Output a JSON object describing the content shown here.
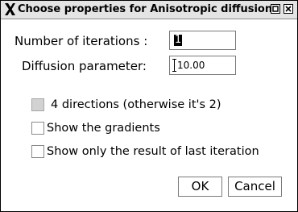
{
  "window": {
    "title": "Choose properties for Anisotropic diffusion",
    "logo_icon": "x-logo-icon",
    "maximize_icon": "maximize-icon",
    "close_icon": "close-icon"
  },
  "fields": {
    "iterations": {
      "label": "Number of iterations :",
      "value": "1"
    },
    "diffusion": {
      "label": "Diffusion parameter:",
      "value": "10.00"
    }
  },
  "options": [
    {
      "label": "4 directions (otherwise it's 2)",
      "checked": false,
      "enabled": false
    },
    {
      "label": "Show the gradients",
      "checked": false,
      "enabled": true
    },
    {
      "label": "Show only the result of last iteration",
      "checked": false,
      "enabled": true
    }
  ],
  "buttons": {
    "ok": "OK",
    "cancel": "Cancel"
  },
  "colors": {
    "titlebar": "#e4e4e4",
    "disabled_checkbox": "#d2d2d2",
    "border": "#7a7a7a"
  }
}
